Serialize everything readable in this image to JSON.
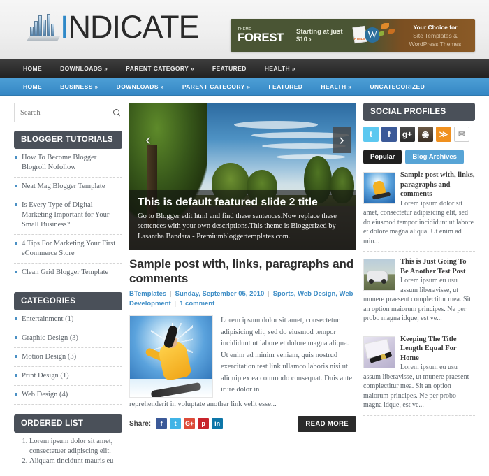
{
  "site": {
    "logo_text_i": "I",
    "logo_text_rest": "NDICATE",
    "logo_icon": "bar-chart-logo-icon"
  },
  "banner": {
    "theme_label": "THEME",
    "brand": "FOREST",
    "offer": "Starting at just $10  ›",
    "right_line1": "Your Choice for",
    "right_line2": "Site Templates &",
    "right_line3": "WordPress Themes",
    "wp_glyph": "W",
    "html_label": "HTML5"
  },
  "nav_top": {
    "items": [
      {
        "label": "HOME"
      },
      {
        "label": "DOWNLOADS »"
      },
      {
        "label": "PARENT CATEGORY »"
      },
      {
        "label": "FEATURED"
      },
      {
        "label": "HEALTH »"
      }
    ]
  },
  "nav_main": {
    "items": [
      {
        "label": "HOME"
      },
      {
        "label": "BUSINESS  »"
      },
      {
        "label": "DOWNLOADS  »"
      },
      {
        "label": "PARENT CATEGORY  »"
      },
      {
        "label": "FEATURED"
      },
      {
        "label": "HEALTH  »"
      },
      {
        "label": "UNCATEGORIZED"
      }
    ]
  },
  "search": {
    "placeholder": "Search",
    "value": "",
    "icon": "search-icon"
  },
  "sidebar_left": {
    "widgets": [
      {
        "title": "BLOGGER TUTORIALS",
        "type": "bullet",
        "items": [
          "How To Become Blogger Blogroll Nofollow",
          "Neat Mag Blogger Template",
          "Is Every Type of Digital Marketing Important for Your Small Business?",
          "4 Tips For Marketing Your First eCommerce Store",
          "Clean Grid Blogger Template"
        ]
      },
      {
        "title": "CATEGORIES",
        "type": "bullet",
        "items": [
          "Entertainment (1)",
          "Graphic Design (3)",
          "Motion Design (3)",
          "Print Design (1)",
          "Web Design (4)"
        ]
      },
      {
        "title": "ORDERED LIST",
        "type": "ordered",
        "items": [
          "Lorem ipsum dolor sit amet, consectetuer adipiscing elit.",
          "Aliquam tincidunt mauris eu"
        ]
      }
    ]
  },
  "slider": {
    "prev_icon": "chevron-left-icon",
    "next_icon": "chevron-right-icon",
    "prev_glyph": "‹",
    "next_glyph": "›",
    "title": "This is default featured slide 2 title",
    "description": "Go to Blogger edit html and find these sentences.Now replace these sentences with your own descriptions.This theme is Bloggerized by Lasantha Bandara - Premiumbloggertemplates.com."
  },
  "post": {
    "title": "Sample post with, links, paragraphs and comments",
    "author": "BTemplates",
    "date": "Sunday, September 05, 2010",
    "categories": "Sports, Web Design, Web Development",
    "comments": "1 comment",
    "body": "Lorem ipsum dolor sit amet, consectetur adipisicing elit, sed do eiusmod tempor incididunt ut labore et dolore magna aliqua. Ut enim ad minim veniam, quis nostrud exercitation test link ullamco laboris nisi ut aliquip ex ea commodo consequat. Duis aute irure dolor in",
    "body_tail": "reprehenderit in voluptate another link velit esse...",
    "share_label": "Share:",
    "read_more": "READ MORE",
    "thumb_icon": "snowboarder-photo",
    "share_buttons": [
      {
        "name": "facebook-share-button",
        "glyph": "f",
        "color": "#3b5998"
      },
      {
        "name": "twitter-share-button",
        "glyph": "t",
        "color": "#41b4e6"
      },
      {
        "name": "googleplus-share-button",
        "glyph": "G+",
        "color": "#dd4b39"
      },
      {
        "name": "pinterest-share-button",
        "glyph": "p",
        "color": "#c8232c"
      },
      {
        "name": "linkedin-share-button",
        "glyph": "in",
        "color": "#0e76a8"
      }
    ]
  },
  "sidebar_right": {
    "social_title": "SOCIAL PROFILES",
    "social_icons": [
      {
        "name": "twitter-icon",
        "glyph": "t",
        "color": "#5cc8f0"
      },
      {
        "name": "facebook-icon",
        "glyph": "f",
        "color": "#3b5998"
      },
      {
        "name": "google-plus-icon",
        "glyph": "g+",
        "color": "#3a3a3a"
      },
      {
        "name": "instagram-icon",
        "glyph": "◉",
        "color": "#4a3a2c"
      },
      {
        "name": "rss-icon",
        "glyph": "≫",
        "color": "#f0901e"
      },
      {
        "name": "email-icon",
        "glyph": "✉",
        "color": "#ffffff"
      }
    ],
    "tabs": [
      {
        "label": "Popular",
        "active": true
      },
      {
        "label": "Blog Archives",
        "active": false
      }
    ],
    "popular_posts": [
      {
        "title": "Sample post with, links, paragraphs and comments",
        "snippet": "Lorem ipsum dolor sit amet, consectetur adipisicing elit, sed do eiusmod tempor incididunt ut labore et dolore magna aliqua. Ut enim ad min...",
        "thumb": "snowboarder-thumb"
      },
      {
        "title": "This is Just Going To Be Another Test Post",
        "snippet": "Lorem ipsum eu usu assum liberavisse, ut munere praesent complectitur mea. Sit an option maiorum principes. Ne per probo magna idque, est ve...",
        "thumb": "van-thumb"
      },
      {
        "title": "Keeping The Title Length Equal For Home",
        "snippet": "Lorem ipsum eu usu assum liberavisse, ut munere praesent complectitur mea. Sit an option maiorum principes. Ne per probo magna idque, est ve...",
        "thumb": "pen-thumb"
      }
    ]
  },
  "colors": {
    "accent_blue": "#3b8fc9",
    "nav_dark": "#2b2b2b",
    "widget_header": "#4a5059",
    "link_blue": "#3f8ec6"
  }
}
